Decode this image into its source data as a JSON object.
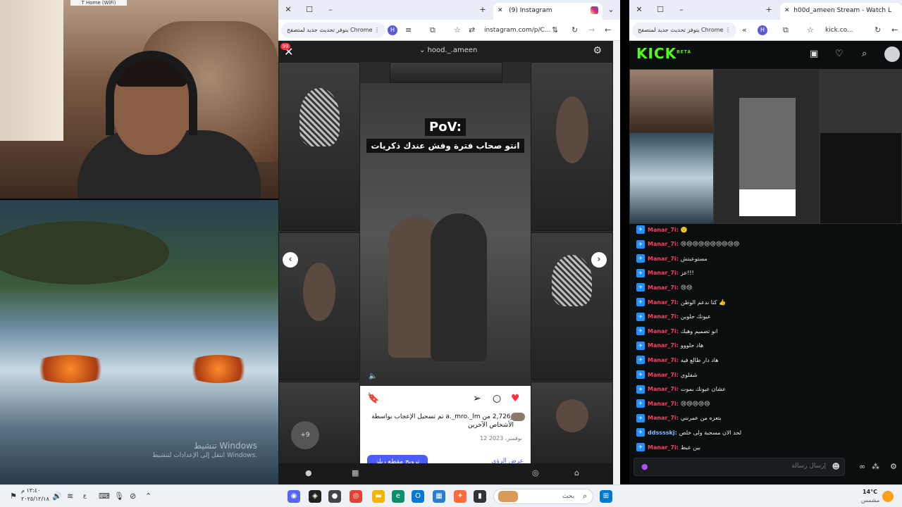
{
  "webcam": {
    "window_tag": "T Home (WiFi)"
  },
  "wallpaper": {
    "activation_title": "تنشيط Windows",
    "activation_sub": "انتقل إلى الإعدادات لتنشيط Windows."
  },
  "ig_window": {
    "tab_title": "(9) Instagram",
    "update_pill": "يتوفر تحديث جديد لمتصفح Chrome",
    "profile_initial": "H",
    "url": "instagram.com/p/C...",
    "notif_count": "99",
    "username": "hood._.ameen",
    "reel": {
      "pov": "PoV:",
      "caption": "انتو صحاب فترة وفش عندك ذكريات"
    },
    "likes_text": "تم تسجيل الإعجاب بواسطة a._mro._lm و2,726 من الأشخاص الآخرين",
    "date": "12 نوفمبر، 2023",
    "boost_label": "ترويج مقطع ريلز",
    "views_label": "عرض الرؤى",
    "activity_badge": "+9"
  },
  "kick_window": {
    "tab_title": "h00d_ameen Stream - Watch L",
    "update_pill": "يتوفر تحديث جديد لمتصفح Chrome",
    "profile_initial": "H",
    "url": "kick.co...",
    "logo": "KICK",
    "logo_beta": "BETA",
    "chat_placeholder": "إرسال رسالة",
    "messages": [
      {
        "user": "Manar_7i:",
        "text": "🙁"
      },
      {
        "user": "Manar_7i:",
        "text": "😢😢😢😢😢😢😢😢😢😢"
      },
      {
        "user": "Manar_7i:",
        "text": "مستوعبتش"
      },
      {
        "user": "Manar_7i:",
        "text": "عز!!!"
      },
      {
        "user": "Manar_7i:",
        "text": "😢😢"
      },
      {
        "user": "Manar_7i:",
        "text": "كنا ندعم الوطن 👍"
      },
      {
        "user": "Manar_7i:",
        "text": "عيونك حلوين"
      },
      {
        "user": "Manar_7i:",
        "text": "انو تصميم وهيك"
      },
      {
        "user": "Manar_7i:",
        "text": "هاد حلووو"
      },
      {
        "user": "Manar_7i:",
        "text": "هاد دار طالع فيه"
      },
      {
        "user": "Manar_7i:",
        "text": "شفلوي"
      },
      {
        "user": "Manar_7i:",
        "text": "عشان عيونك بموت"
      },
      {
        "user": "Manar_7i:",
        "text": "😢😢😢😢😢"
      },
      {
        "user": "Manar_7i:",
        "text": "بتعزه من عمرنني"
      },
      {
        "user": "ddsssskj:",
        "text": "لحد الان مسحبة ولى خلص"
      },
      {
        "user": "Manar_7i:",
        "text": "بين عبط"
      }
    ]
  },
  "taskbar": {
    "search_placeholder": "بحث",
    "weather_temp": "14°C",
    "weather_desc": "مشمس",
    "time": "١٣:٤٠ م",
    "date": "٢٠٢٥/١٢/١٨",
    "lang": "ع"
  },
  "colors": {
    "kick_green": "#53fc18",
    "ig_blue": "#4a5df9",
    "chat_user": "#ff3d63",
    "like_red": "#ff3040"
  }
}
